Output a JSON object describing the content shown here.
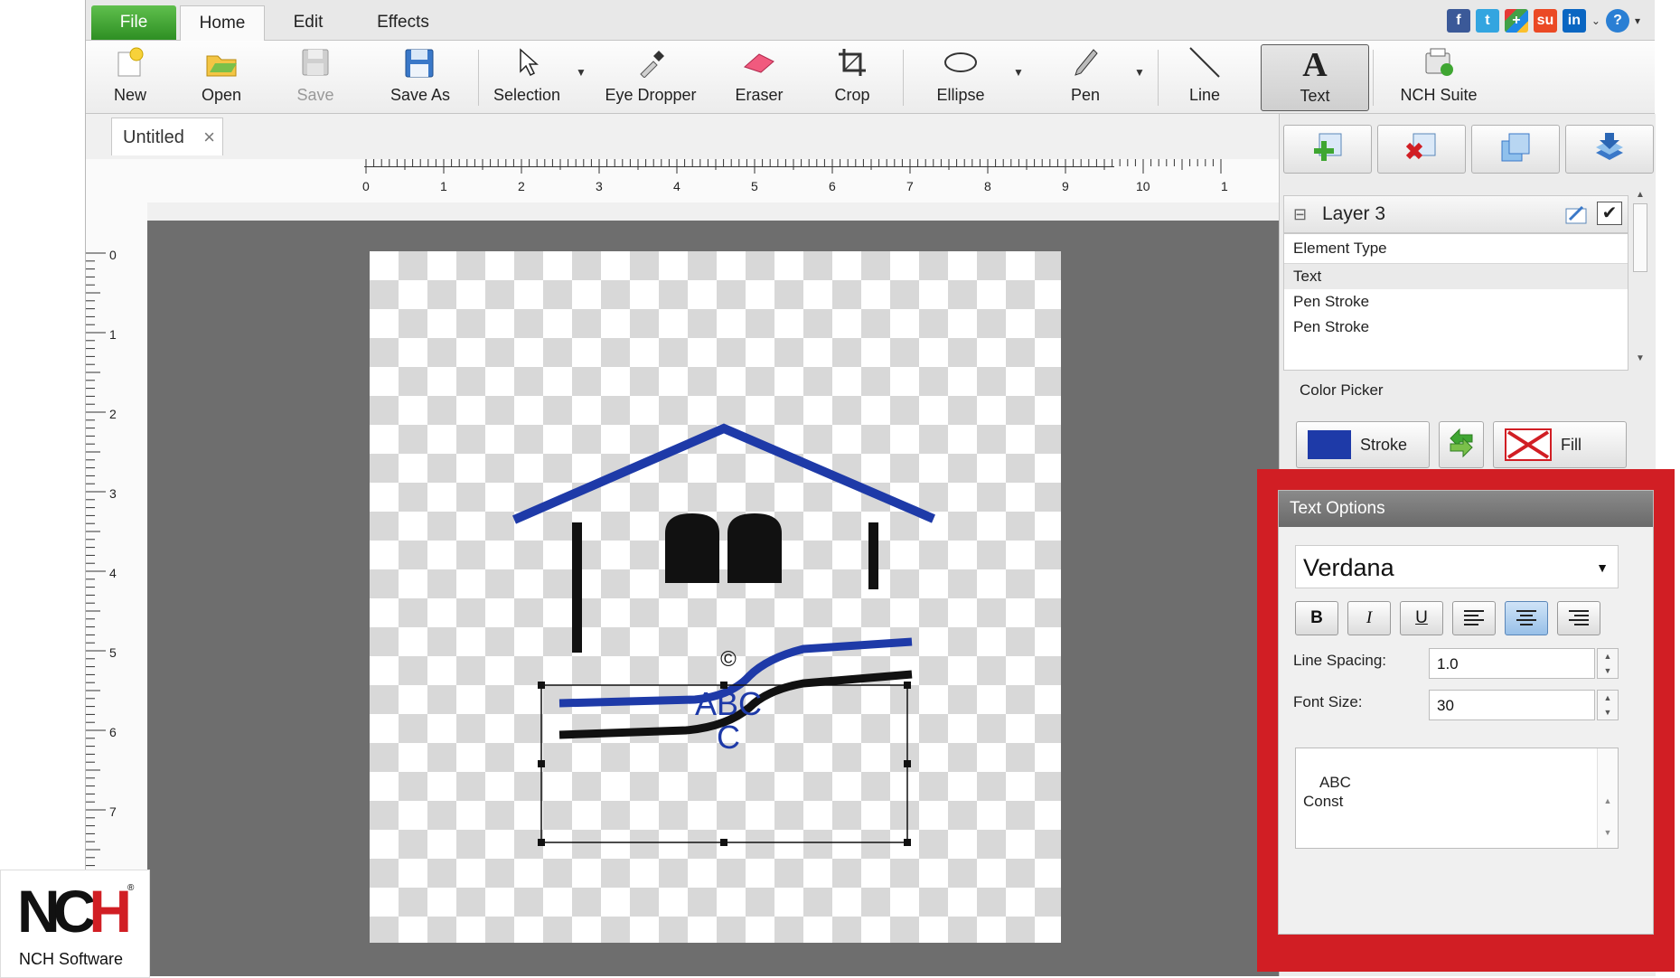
{
  "menu": {
    "file": "File",
    "home": "Home",
    "edit": "Edit",
    "effects": "Effects"
  },
  "social": [
    "facebook-icon",
    "twitter-icon",
    "google-plus-icon",
    "stumbleupon-icon",
    "linkedin-icon",
    "help-icon"
  ],
  "ribbon": {
    "new": "New",
    "open": "Open",
    "save": "Save",
    "save_as": "Save As",
    "selection": "Selection",
    "eye_dropper": "Eye Dropper",
    "eraser": "Eraser",
    "crop": "Crop",
    "ellipse": "Ellipse",
    "pen": "Pen",
    "line": "Line",
    "text": "Text",
    "nch_suite": "NCH Suite"
  },
  "document": {
    "tab_title": "Untitled",
    "close": "×"
  },
  "ruler": {
    "horizontal": [
      "0",
      "1",
      "2",
      "3",
      "4",
      "5",
      "6",
      "7",
      "8",
      "9",
      "10",
      "1"
    ],
    "vertical": [
      "0",
      "1",
      "2",
      "3",
      "4",
      "5",
      "6",
      "7"
    ]
  },
  "canvas": {
    "copyright": "©",
    "text_line1": "ABC",
    "text_line2": "C"
  },
  "layers": {
    "title": "Layer 3",
    "column_header": "Element Type",
    "items": [
      "Text",
      "Pen Stroke",
      "Pen Stroke"
    ]
  },
  "color_picker": {
    "label": "Color Picker",
    "stroke": "Stroke",
    "fill": "Fill",
    "stroke_color": "#1e3aa8",
    "fill_color": "none"
  },
  "text_options": {
    "title": "Text Options",
    "font": "Verdana",
    "bold": "B",
    "italic": "I",
    "underline": "U",
    "line_spacing_label": "Line Spacing:",
    "line_spacing": "1.0",
    "font_size_label": "Font Size:",
    "font_size": "30",
    "text": "ABC\nConst"
  },
  "logo": {
    "mark": "NCH",
    "company": "NCH Software"
  },
  "colors": {
    "accent_green": "#3fa632",
    "highlight_red": "#d11e24",
    "brand_blue": "#1e3aa8"
  }
}
